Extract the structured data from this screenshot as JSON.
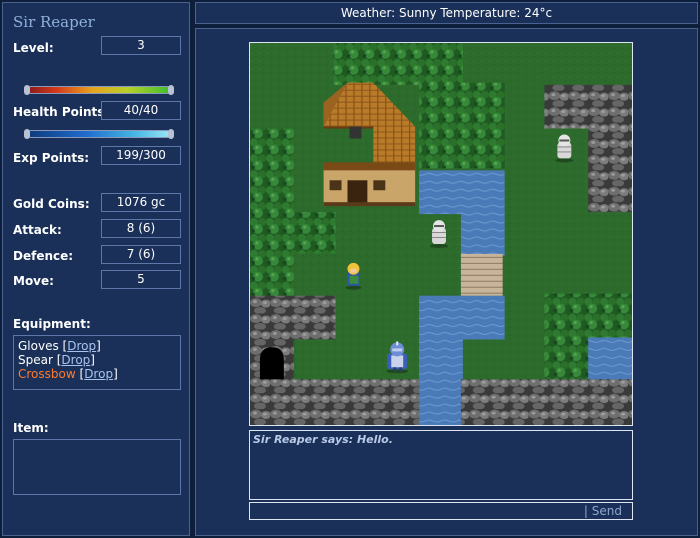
{
  "character": {
    "name": "Sir Reaper",
    "level_label": "Level:",
    "level": "3",
    "health_label": "Health Points:",
    "health": "40/40",
    "health_fraction": 1.0,
    "exp_label": "Exp Points:",
    "exp": "199/300",
    "exp_fraction": 0.663,
    "gold_label": "Gold Coins:",
    "gold": "1076 gc",
    "attack_label": "Attack:",
    "attack": "8 (6)",
    "defence_label": "Defence:",
    "defence": "7 (6)",
    "move_label": "Move:",
    "move": "5"
  },
  "equipment": {
    "label": "Equipment:",
    "items": [
      {
        "name": "Gloves",
        "drop": "Drop",
        "active": false
      },
      {
        "name": "Spear",
        "drop": "Drop",
        "active": false
      },
      {
        "name": "Crossbow",
        "drop": "Drop",
        "active": true
      }
    ]
  },
  "item": {
    "label": "Item:"
  },
  "topbar": {
    "weather": "Weather: Sunny Temperature: 24°c"
  },
  "chat": {
    "messages": [
      {
        "speaker": "Sir Reaper says:",
        "text": "Hello."
      }
    ],
    "send_label": "| Send",
    "input_value": ""
  },
  "map": {
    "sprites": [
      {
        "name": "player-knight-sprite",
        "kind": "player"
      },
      {
        "name": "blonde-adventurer-sprite",
        "kind": "npc"
      },
      {
        "name": "mummy-sprite",
        "kind": "enemy"
      },
      {
        "name": "mummy-sprite",
        "kind": "enemy"
      }
    ]
  },
  "colors": {
    "background": "#0e1f3c",
    "panel": "#1a3058",
    "border": "#4a6290",
    "grass": "#2d6b2d",
    "water": "#4a7ab8",
    "rock": "#5a5a5a",
    "active_equipment": "#ff7a30",
    "link": "#a8c4ee"
  }
}
